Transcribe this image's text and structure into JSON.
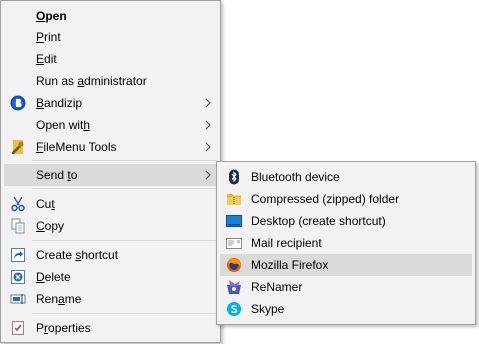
{
  "main_menu": {
    "items": [
      {
        "label": "Open",
        "accel_index": 0,
        "bold": true
      },
      {
        "label": "Print",
        "accel_index": 0
      },
      {
        "label": "Edit",
        "accel_index": 0
      },
      {
        "label": "Run as administrator",
        "accel_index": 7
      },
      {
        "label": "Bandizip",
        "accel_index": 0,
        "icon": "bandizip-icon",
        "submenu": true
      },
      {
        "label": "Open with",
        "accel_index": 8,
        "submenu": true
      },
      {
        "label": "FileMenu Tools",
        "accel_index": 0,
        "icon": "filemenu-tools-icon",
        "submenu": true
      },
      {
        "label": "Send to",
        "accel_index": 5,
        "submenu": true,
        "highlighted": true
      },
      {
        "label": "Cut",
        "accel_index": 2,
        "icon": "scissors-icon"
      },
      {
        "label": "Copy",
        "accel_index": 0,
        "icon": "copy-icon"
      },
      {
        "label": "Create shortcut",
        "accel_index": 7,
        "icon": "shortcut-icon"
      },
      {
        "label": "Delete",
        "accel_index": 0,
        "icon": "delete-icon"
      },
      {
        "label": "Rename",
        "accel_index": 3,
        "icon": "rename-icon"
      },
      {
        "label": "Properties",
        "accel_index": 1,
        "icon": "properties-icon"
      }
    ]
  },
  "send_to_menu": {
    "items": [
      {
        "label": "Bluetooth device",
        "icon": "bluetooth-icon"
      },
      {
        "label": "Compressed (zipped) folder",
        "icon": "zip-folder-icon"
      },
      {
        "label": "Desktop (create shortcut)",
        "icon": "desktop-icon"
      },
      {
        "label": "Mail recipient",
        "icon": "mail-icon"
      },
      {
        "label": "Mozilla Firefox",
        "icon": "firefox-icon",
        "highlighted": true
      },
      {
        "label": "ReNamer",
        "icon": "renamer-icon"
      },
      {
        "label": "Skype",
        "icon": "skype-icon"
      }
    ]
  },
  "colors": {
    "menu_bg": "#f2f2f2",
    "highlight": "#dadada",
    "border": "#a0a0a0",
    "separator": "#d7d7d7"
  }
}
